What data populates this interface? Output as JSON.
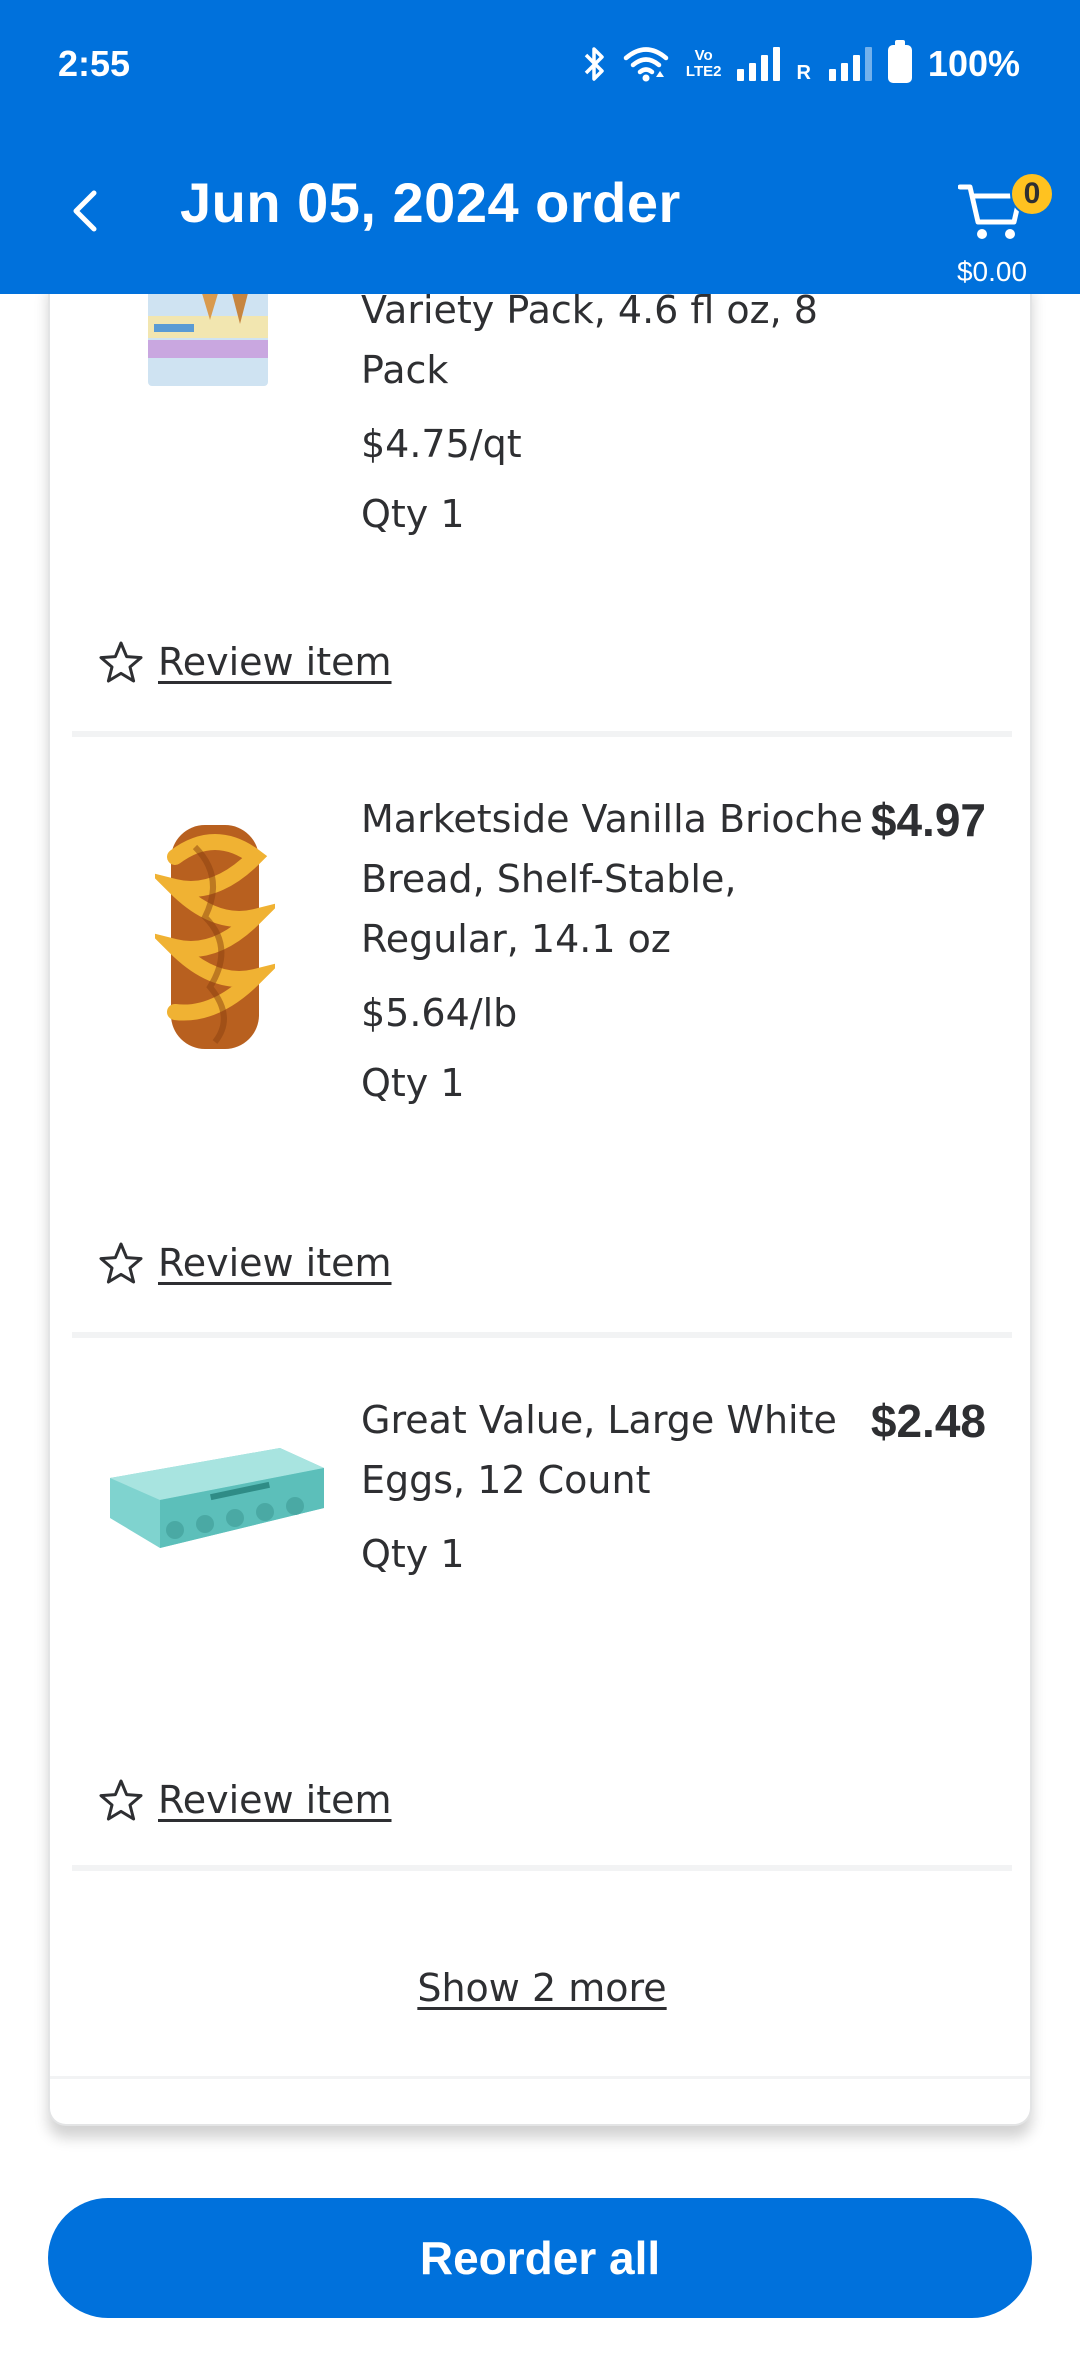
{
  "status_bar": {
    "time": "2:55",
    "battery": "100%",
    "volte_top": "Vo",
    "volte_bottom": "LTE2",
    "roaming": "R"
  },
  "header": {
    "title": "Jun 05, 2024 order",
    "cart_count": "0",
    "cart_total": "$0.00"
  },
  "items": [
    {
      "name": "Variety Pack, 4.6 fl oz, 8 Pack",
      "unit_price": "$4.75/qt",
      "qty": "Qty 1",
      "price": "",
      "review_label": "Review item"
    },
    {
      "name": "Marketside Vanilla Brioche Bread, Shelf-Stable, Regular, 14.1 oz",
      "unit_price": "$5.64/lb",
      "qty": "Qty 1",
      "price": "$4.97",
      "review_label": "Review item"
    },
    {
      "name": "Great Value, Large White Eggs, 12 Count",
      "unit_price": "",
      "qty": "Qty 1",
      "price": "$2.48",
      "review_label": "Review item"
    }
  ],
  "show_more_label": "Show 2 more",
  "reorder_label": "Reorder all",
  "colors": {
    "brand_blue": "#0071dc",
    "badge_yellow": "#ffc220",
    "text": "#2e2f32"
  }
}
